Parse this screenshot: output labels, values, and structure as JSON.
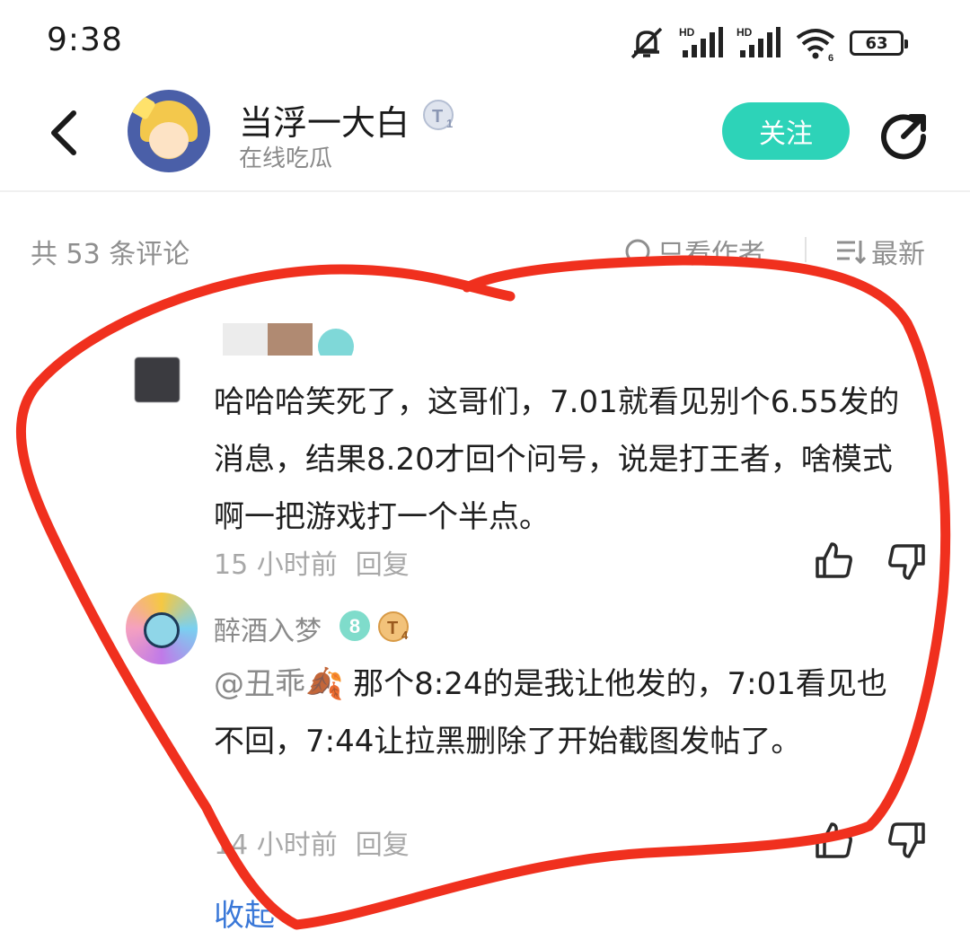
{
  "status_bar": {
    "time": "9:38",
    "battery": "63",
    "icons": [
      "mute-bell-icon",
      "signal-hd-icon",
      "signal-hd-icon",
      "wifi-icon",
      "battery-icon"
    ]
  },
  "header": {
    "name": "当浮一大白",
    "badge": "T1",
    "subtitle": "在线吃瓜",
    "follow_label": "关注"
  },
  "comments_header": {
    "count": "共 53 条评论",
    "only_author": "只看作者",
    "sort": "最新"
  },
  "comment": {
    "text": "哈哈哈笑死了，这哥们，7.01就看见别个6.55发的消息，结果8.20才回个问号，说是打王者，啥模式啊一把游戏打一个半点。",
    "time": "15 小时前",
    "reply_label": "回复"
  },
  "reply": {
    "name": "醉酒入梦",
    "level": "8",
    "badge": "T4",
    "mention": "@丑乖🍂",
    "text": " 那个8:24的是我让他发的，7:01看见也不回，7:44让拉黑删除了开始截图发帖了。",
    "time": "14 小时前",
    "reply_label": "回复"
  },
  "collapse_label": "收起",
  "colors": {
    "accent": "#2dd3b8",
    "link": "#3a78d8",
    "annotation": "#f0301e"
  }
}
